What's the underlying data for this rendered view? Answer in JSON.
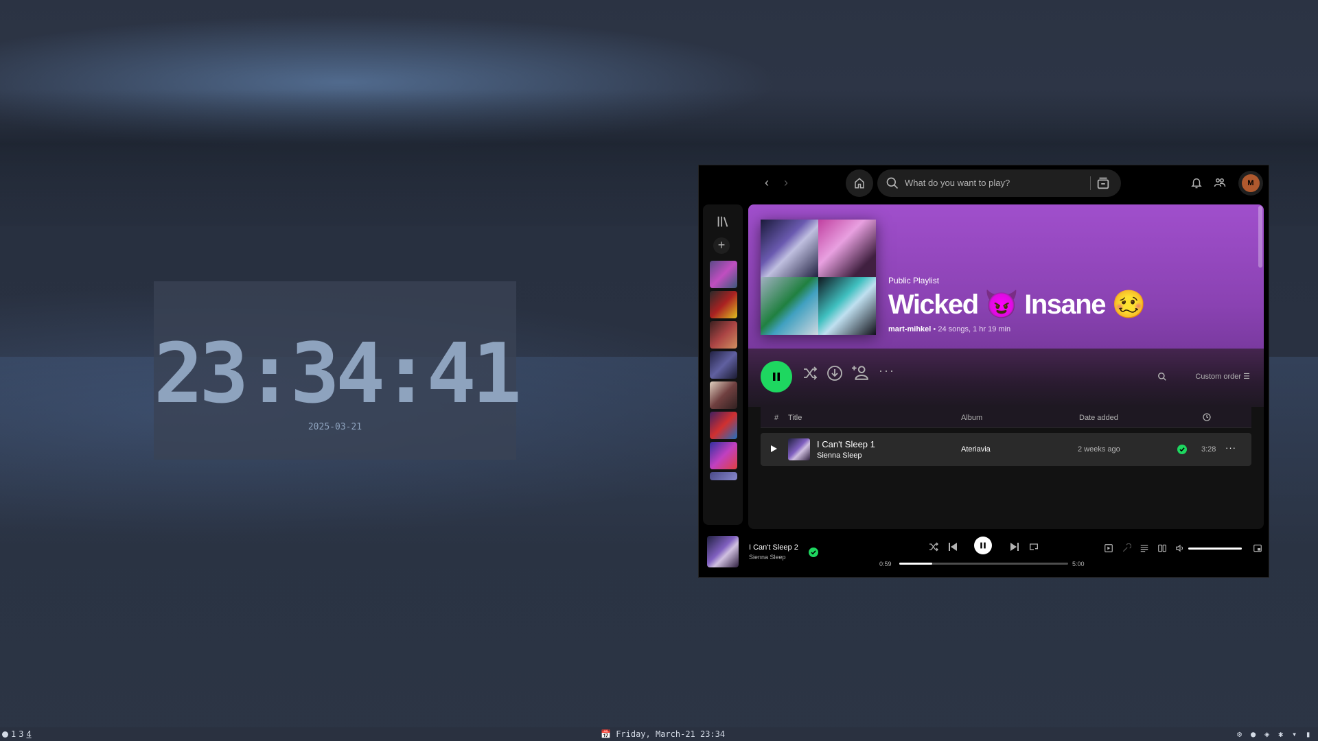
{
  "desktop": {
    "clock_time": "23:34:41",
    "clock_date": "2025-03-21"
  },
  "taskbar": {
    "workspaces": [
      "1",
      "3",
      "4"
    ],
    "active_workspace": "4",
    "datetime": "Friday, March-21 23:34"
  },
  "spotify": {
    "search_placeholder": "What do you want to play?",
    "avatar_initial": "M",
    "playlist": {
      "type": "Public Playlist",
      "title": "Wicked 😈 Insane 🥴",
      "owner": "mart-mihkel",
      "meta": " • 24 songs, 1 hr 19 min"
    },
    "sort_label": "Custom order",
    "columns": {
      "number": "#",
      "title": "Title",
      "album": "Album",
      "date_added": "Date added"
    },
    "tracks": [
      {
        "title": "I Can't Sleep 1",
        "artist": "Sienna Sleep",
        "album": "Ateriavia",
        "date_added": "2 weeks ago",
        "duration": "3:28",
        "saved": true
      }
    ],
    "now_playing": {
      "title": "I Can't Sleep 2",
      "artist": "Sienna Sleep",
      "elapsed": "0:59",
      "total": "5:00",
      "progress": 0.197,
      "volume": 1.0
    },
    "colors": {
      "accent": "#1ed760",
      "hero": "#a04fcc"
    }
  }
}
